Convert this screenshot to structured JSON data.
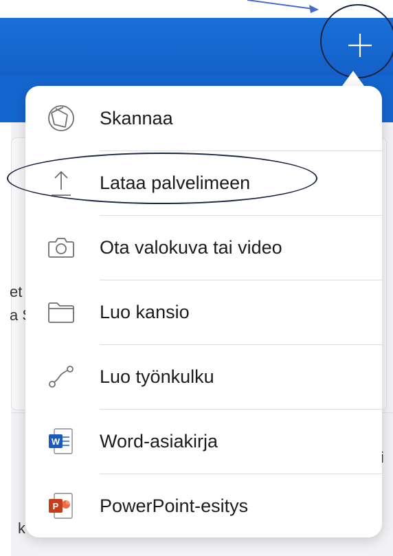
{
  "menu": {
    "items": [
      {
        "id": "scan",
        "label": "Skannaa",
        "icon": "scan-icon"
      },
      {
        "id": "upload",
        "label": "Lataa palvelimeen",
        "icon": "upload-icon"
      },
      {
        "id": "camera",
        "label": "Ota valokuva tai video",
        "icon": "camera-icon"
      },
      {
        "id": "folder",
        "label": "Luo kansio",
        "icon": "folder-icon"
      },
      {
        "id": "workflow",
        "label": "Luo työnkulku",
        "icon": "workflow-icon"
      },
      {
        "id": "word",
        "label": "Word-asiakirja",
        "icon": "word-icon"
      },
      {
        "id": "powerpoint",
        "label": "PowerPoint-esitys",
        "icon": "powerpoint-icon"
      }
    ]
  },
  "background": {
    "fragments": [
      "et",
      "a S",
      "i",
      "k"
    ]
  },
  "colors": {
    "header_blue": "#1565cf",
    "word_blue": "#185abd",
    "powerpoint_orange": "#c43e1c",
    "annotation": "#1a2440"
  }
}
